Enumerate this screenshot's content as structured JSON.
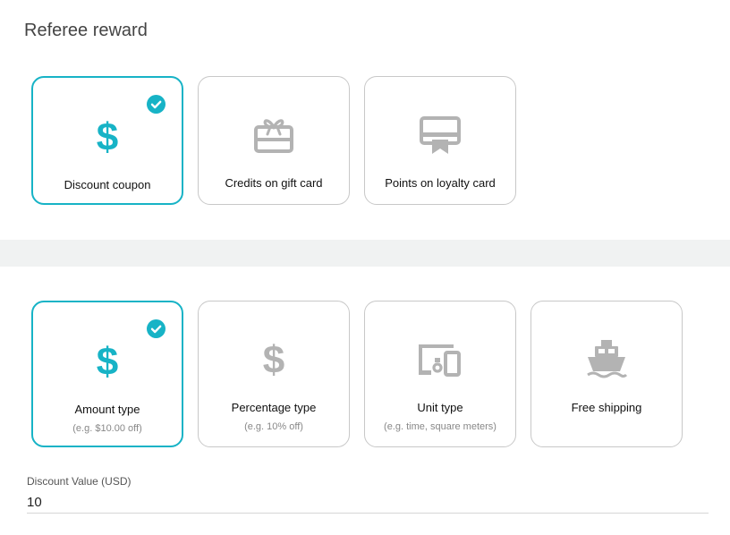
{
  "section_title": "Referee reward",
  "reward_types": [
    {
      "label": "Discount coupon",
      "icon": "dollar-icon",
      "selected": true
    },
    {
      "label": "Credits on gift card",
      "icon": "gift-card-icon",
      "selected": false
    },
    {
      "label": "Points on loyalty card",
      "icon": "loyalty-card-icon",
      "selected": false
    }
  ],
  "discount_types": [
    {
      "label": "Amount type",
      "sub": "(e.g. $10.00 off)",
      "icon": "dollar-icon",
      "selected": true
    },
    {
      "label": "Percentage type",
      "sub": "(e.g. 10% off)",
      "icon": "dollar-icon",
      "selected": false
    },
    {
      "label": "Unit type",
      "sub": "(e.g. time, square meters)",
      "icon": "devices-icon",
      "selected": false
    },
    {
      "label": "Free shipping",
      "sub": "",
      "icon": "ship-icon",
      "selected": false
    }
  ],
  "discount_value": {
    "label": "Discount Value (USD)",
    "value": "10"
  },
  "colors": {
    "accent": "#17b3c6",
    "inactive_icon": "#b3b3b3",
    "divider": "#f0f2f2"
  }
}
